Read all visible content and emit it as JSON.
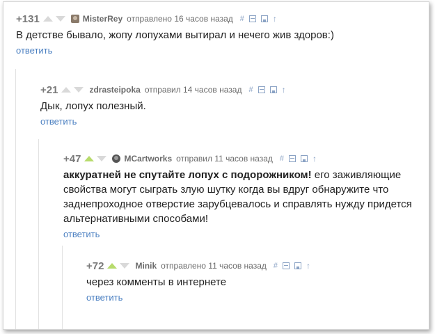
{
  "comments": [
    {
      "rating": "+131",
      "author": "MisterRey",
      "time": "отправлено 16 часов назад",
      "text_bold": "",
      "text": "В детстве бывало, жопу лопухами вытирал и нечего жив здоров:)",
      "reply": "ответить"
    },
    {
      "rating": "+21",
      "author": "zdrasteipoka",
      "time": "отправил 14 часов назад",
      "text_bold": "",
      "text": "Дык, лопух полезный.",
      "reply": "ответить"
    },
    {
      "rating": "+47",
      "author": "MCartworks",
      "time": "отправил 11 часов назад",
      "text_bold": "аккуратней не спутайте лопух с подорожником!",
      "text": " его заживляющие свойства могут сыграть злую шутку когда вы вдруг обнаружите что заднепроходное отверстие зарубцевалось и справлять нужду придется альтернативными способами!",
      "reply": "ответить"
    },
    {
      "rating": "+72",
      "author": "Minik",
      "time": "отправлено 11 часов назад",
      "text_bold": "",
      "text": "через комменты в интернете",
      "reply": "ответить"
    }
  ],
  "tools": {
    "hash": "#",
    "up": "↑"
  },
  "colors": {
    "link": "#4a7fc1",
    "vote_active": "#b7db6c",
    "vote_inactive": "#d9d9d9"
  }
}
